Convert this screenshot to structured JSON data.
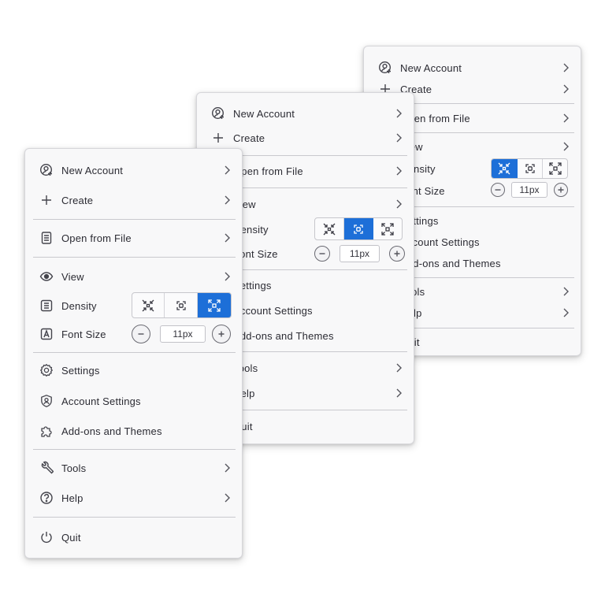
{
  "menu": {
    "new_account": "New Account",
    "create": "Create",
    "open_from_file": "Open from File",
    "view": "View",
    "density": "Density",
    "font_size": "Font Size",
    "font_size_value": "11px",
    "settings": "Settings",
    "account_settings": "Account Settings",
    "addons_themes": "Add-ons and Themes",
    "tools": "Tools",
    "help": "Help",
    "quit": "Quit"
  },
  "density_options": [
    "compact",
    "normal",
    "touch"
  ],
  "menus_selected_density": {
    "front": "touch",
    "middle": "normal",
    "back": "compact"
  },
  "colors": {
    "accent": "#1d6fd8",
    "menu_background": "#f8f8f9",
    "separator": "#c9c9ce"
  }
}
